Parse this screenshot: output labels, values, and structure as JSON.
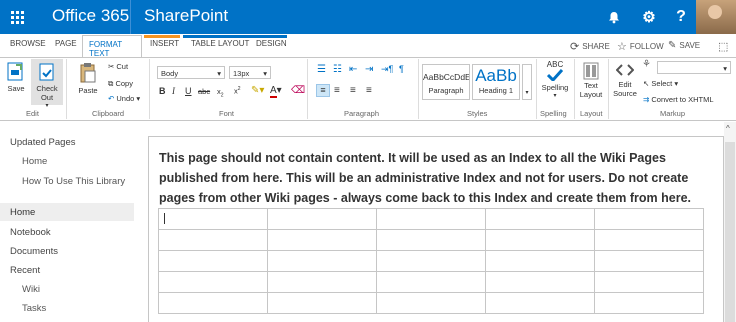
{
  "suitebar": {
    "app": "Office 365",
    "product": "SharePoint",
    "question": "?"
  },
  "tabs": [
    "BROWSE",
    "PAGE",
    "FORMAT TEXT",
    "INSERT",
    "TABLE LAYOUT",
    "DESIGN"
  ],
  "ribbon_right": {
    "share": "SHARE",
    "follow": "FOLLOW",
    "save": "SAVE"
  },
  "ribbon": {
    "save": "Save",
    "checkout": "Check Out",
    "paste": "Paste",
    "cut": "Cut",
    "copy": "Copy",
    "undo": "Undo",
    "font_name": "Body",
    "font_size": "13px",
    "style1": "AaBbCcDdE",
    "style1_label": "Paragraph",
    "style2": "AaBb",
    "style2_label": "Heading 1",
    "spelling_abc": "ABC",
    "spelling": "Spelling",
    "text_layout": "Text Layout",
    "edit_source": "Edit Source",
    "select": "Select",
    "convert": "Convert to XHTML",
    "groups": {
      "edit": "Edit",
      "clipboard": "Clipboard",
      "font": "Font",
      "paragraph": "Paragraph",
      "styles": "Styles",
      "spelling": "Spelling",
      "layout": "Layout",
      "markup": "Markup"
    }
  },
  "nav": {
    "updated_pages": "Updated Pages",
    "home_sub": "Home",
    "how_to": "How To Use This Library",
    "home": "Home",
    "notebook": "Notebook",
    "documents": "Documents",
    "recent": "Recent",
    "wiki": "Wiki",
    "tasks": "Tasks"
  },
  "content": {
    "text": "This page should not contain content. It will be used as an Index to all the Wiki Pages published from here. This will be an administrative Index and not for users. Do not create pages from other Wiki pages - always come back to this Index and create them from here."
  }
}
